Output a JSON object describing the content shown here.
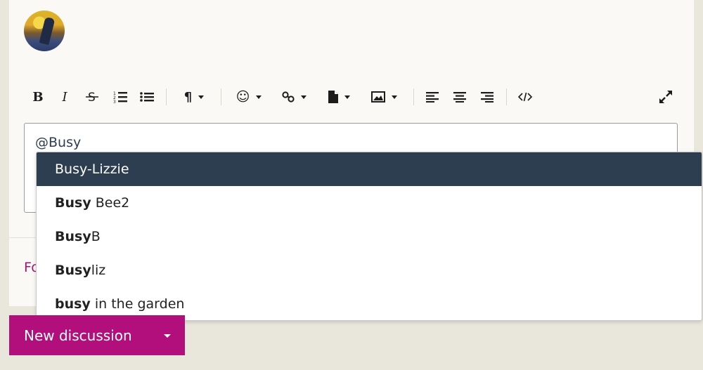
{
  "editor": {
    "typed_text": "@Busy"
  },
  "toolbar": {
    "bold": "B",
    "italic": "I",
    "paragraph": "¶",
    "emoji": "☺"
  },
  "follow_text_partial": "Fo",
  "mentions": {
    "query_bold": [
      "",
      "Busy",
      "Busy",
      "Busy",
      "busy"
    ],
    "items": [
      {
        "bold": "",
        "rest": "Busy-Lizzie"
      },
      {
        "bold": "Busy",
        "rest": " Bee2"
      },
      {
        "bold": "Busy",
        "rest": "B"
      },
      {
        "bold": "Busy",
        "rest": "liz"
      },
      {
        "bold": "busy",
        "rest": " in the garden"
      }
    ]
  },
  "new_discussion": {
    "label": "New discussion"
  },
  "colors": {
    "accent": "#b20f7d",
    "highlight": "#2d3e50",
    "page_bg": "#e9e7dc"
  }
}
